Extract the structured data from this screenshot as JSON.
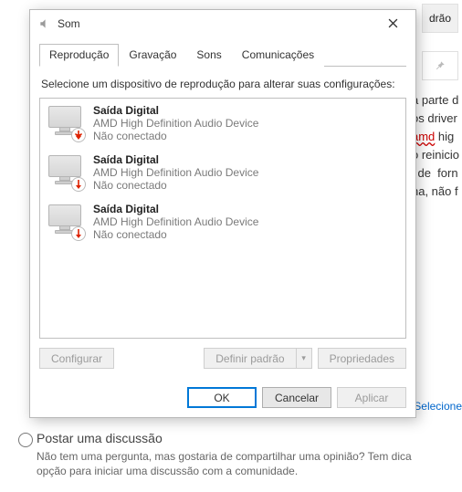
{
  "background": {
    "top_button_label": "drão",
    "selecione_link": "Selecione",
    "side_text_lines": [
      "a parte d",
      "os driver",
      " hig",
      "o reinicio",
      "i de  forn",
      "na, não f"
    ],
    "side_red_word": "amd",
    "discuss": {
      "title": "Postar uma discussão",
      "line1": "Não tem uma pergunta, mas gostaria de compartilhar uma opinião? Tem dica",
      "line2": "opção para iniciar uma discussão com a comunidade."
    }
  },
  "dialog": {
    "title": "Som",
    "tabs": [
      {
        "label": "Reprodução",
        "active": true
      },
      {
        "label": "Gravação",
        "active": false
      },
      {
        "label": "Sons",
        "active": false
      },
      {
        "label": "Comunicações",
        "active": false
      }
    ],
    "instruction": "Selecione um dispositivo de reprodução para alterar suas configurações:",
    "devices": [
      {
        "name": "Saída Digital",
        "desc": "AMD High Definition Audio Device",
        "status": "Não conectado"
      },
      {
        "name": "Saída Digital",
        "desc": "AMD High Definition Audio Device",
        "status": "Não conectado"
      },
      {
        "name": "Saída Digital",
        "desc": "AMD High Definition Audio Device",
        "status": "Não conectado"
      }
    ],
    "buttons": {
      "configure": "Configurar",
      "set_default": "Definir padrão",
      "properties": "Propriedades",
      "ok": "OK",
      "cancel": "Cancelar",
      "apply": "Aplicar"
    }
  }
}
